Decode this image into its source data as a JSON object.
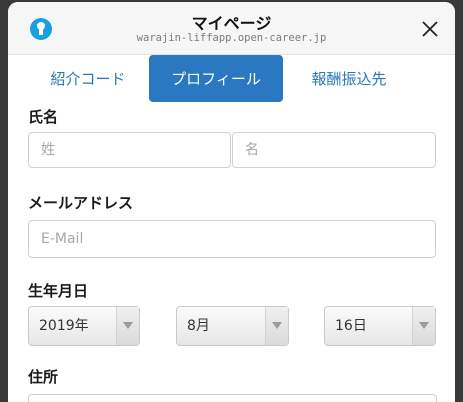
{
  "header": {
    "title": "マイページ",
    "url": "warajin-liffapp.open-career.jp",
    "app_icon": "lightbulb-icon",
    "close_icon": "close-icon"
  },
  "tabs": [
    {
      "label": "紹介コード",
      "active": false
    },
    {
      "label": "プロフィール",
      "active": true
    },
    {
      "label": "報酬振込先",
      "active": false
    }
  ],
  "form": {
    "name_label": "氏名",
    "last_name_placeholder": "姓",
    "first_name_placeholder": "名",
    "email_label": "メールアドレス",
    "email_placeholder": "E-Mail",
    "birthdate_label": "生年月日",
    "birth_year": "2019年",
    "birth_month": "8月",
    "birth_day": "16日",
    "address_label": "住所"
  },
  "colors": {
    "accent": "#2a78c2",
    "tab_text": "#2a77b8",
    "app_icon": "#1a9fe0"
  }
}
